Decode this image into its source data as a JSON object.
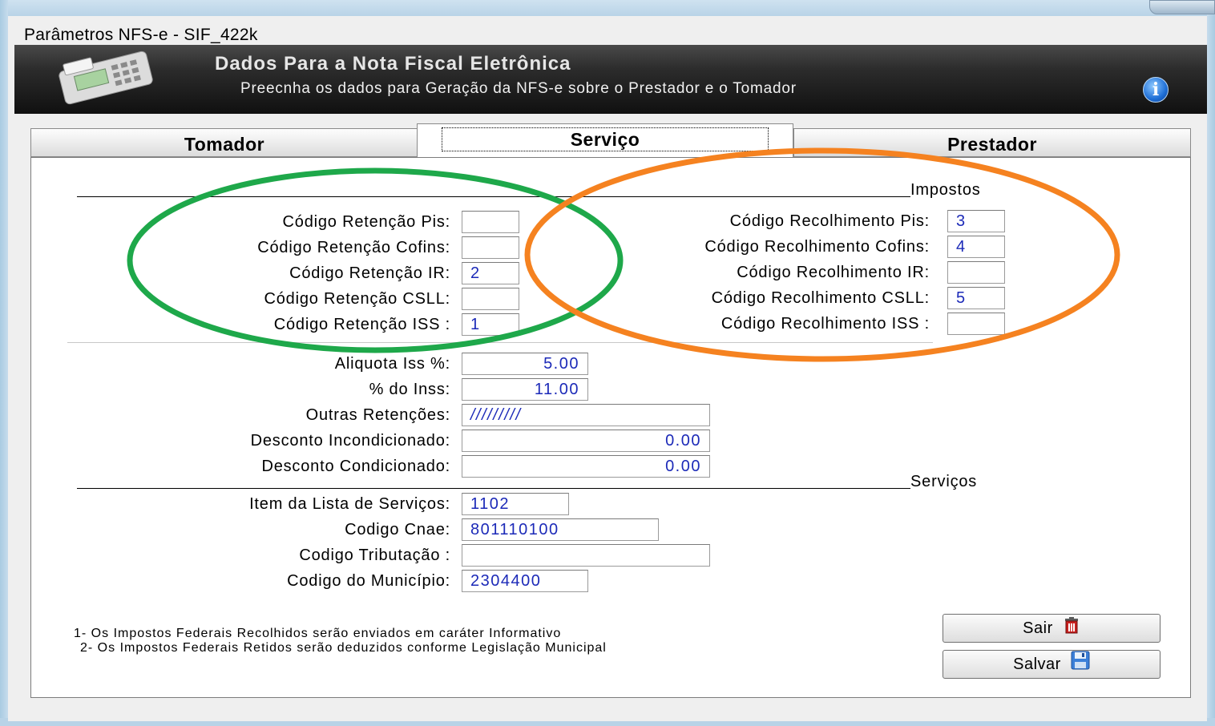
{
  "window": {
    "title": "Parâmetros NFS-e - SIF_422k"
  },
  "banner": {
    "title": "Dados Para a Nota Fiscal Eletrônica",
    "subtitle": "Preecnha os dados para Geração da NFS-e sobre o Prestador e o Tomador",
    "icon": "pos-terminal-icon",
    "info_icon": "info-icon"
  },
  "tabs": [
    {
      "label": "Tomador",
      "active": false
    },
    {
      "label": "Serviço",
      "active": true
    },
    {
      "label": "Prestador",
      "active": false
    }
  ],
  "impostos": {
    "group_label": "Impostos",
    "retencao": [
      {
        "label": "Código Retenção Pis:",
        "value": ""
      },
      {
        "label": "Código Retenção Cofins:",
        "value": ""
      },
      {
        "label": "Código Retenção IR:",
        "value": "2"
      },
      {
        "label": "Código Retenção CSLL:",
        "value": ""
      },
      {
        "label": "Código Retenção ISS :",
        "value": "1"
      }
    ],
    "recolhimento": [
      {
        "label": "Código Recolhimento Pis:",
        "value": "3"
      },
      {
        "label": "Código Recolhimento Cofins:",
        "value": "4"
      },
      {
        "label": "Código Recolhimento IR:",
        "value": ""
      },
      {
        "label": "Código Recolhimento CSLL:",
        "value": "5"
      },
      {
        "label": "Código Recolhimento ISS :",
        "value": ""
      }
    ]
  },
  "valores": [
    {
      "label": "Aliquota Iss %:",
      "value": "5.00"
    },
    {
      "label": "% do Inss:",
      "value": "11.00"
    },
    {
      "label": "Outras Retenções:",
      "value": "/////////"
    },
    {
      "label": "Desconto Incondicionado:",
      "value": "0.00"
    },
    {
      "label": "Desconto Condicionado:",
      "value": "0.00"
    }
  ],
  "servicos": {
    "group_label": "Serviços",
    "fields": [
      {
        "label": "Item da Lista de Serviços:",
        "value": "1102"
      },
      {
        "label": "Codigo Cnae:",
        "value": "801110100"
      },
      {
        "label": "Codigo Tributação :",
        "value": ""
      },
      {
        "label": "Codigo do Município:",
        "value": "2304400"
      }
    ]
  },
  "notes": [
    "1- Os Impostos Federais Recolhidos serão enviados em caráter Informativo",
    "2- Os Impostos Federais Retidos serão deduzidos conforme Legislação Municipal"
  ],
  "buttons": {
    "sair": "Sair",
    "sair_icon": "trash-icon",
    "salvar": "Salvar",
    "salvar_icon": "floppy-disk-icon"
  },
  "annotations": {
    "retencao_circle_color": "#1ea84a",
    "recolhimento_circle_color": "#f58220"
  },
  "colors": {
    "field_text": "#1c2ab8",
    "banner_bg": "#1e1e1e"
  }
}
